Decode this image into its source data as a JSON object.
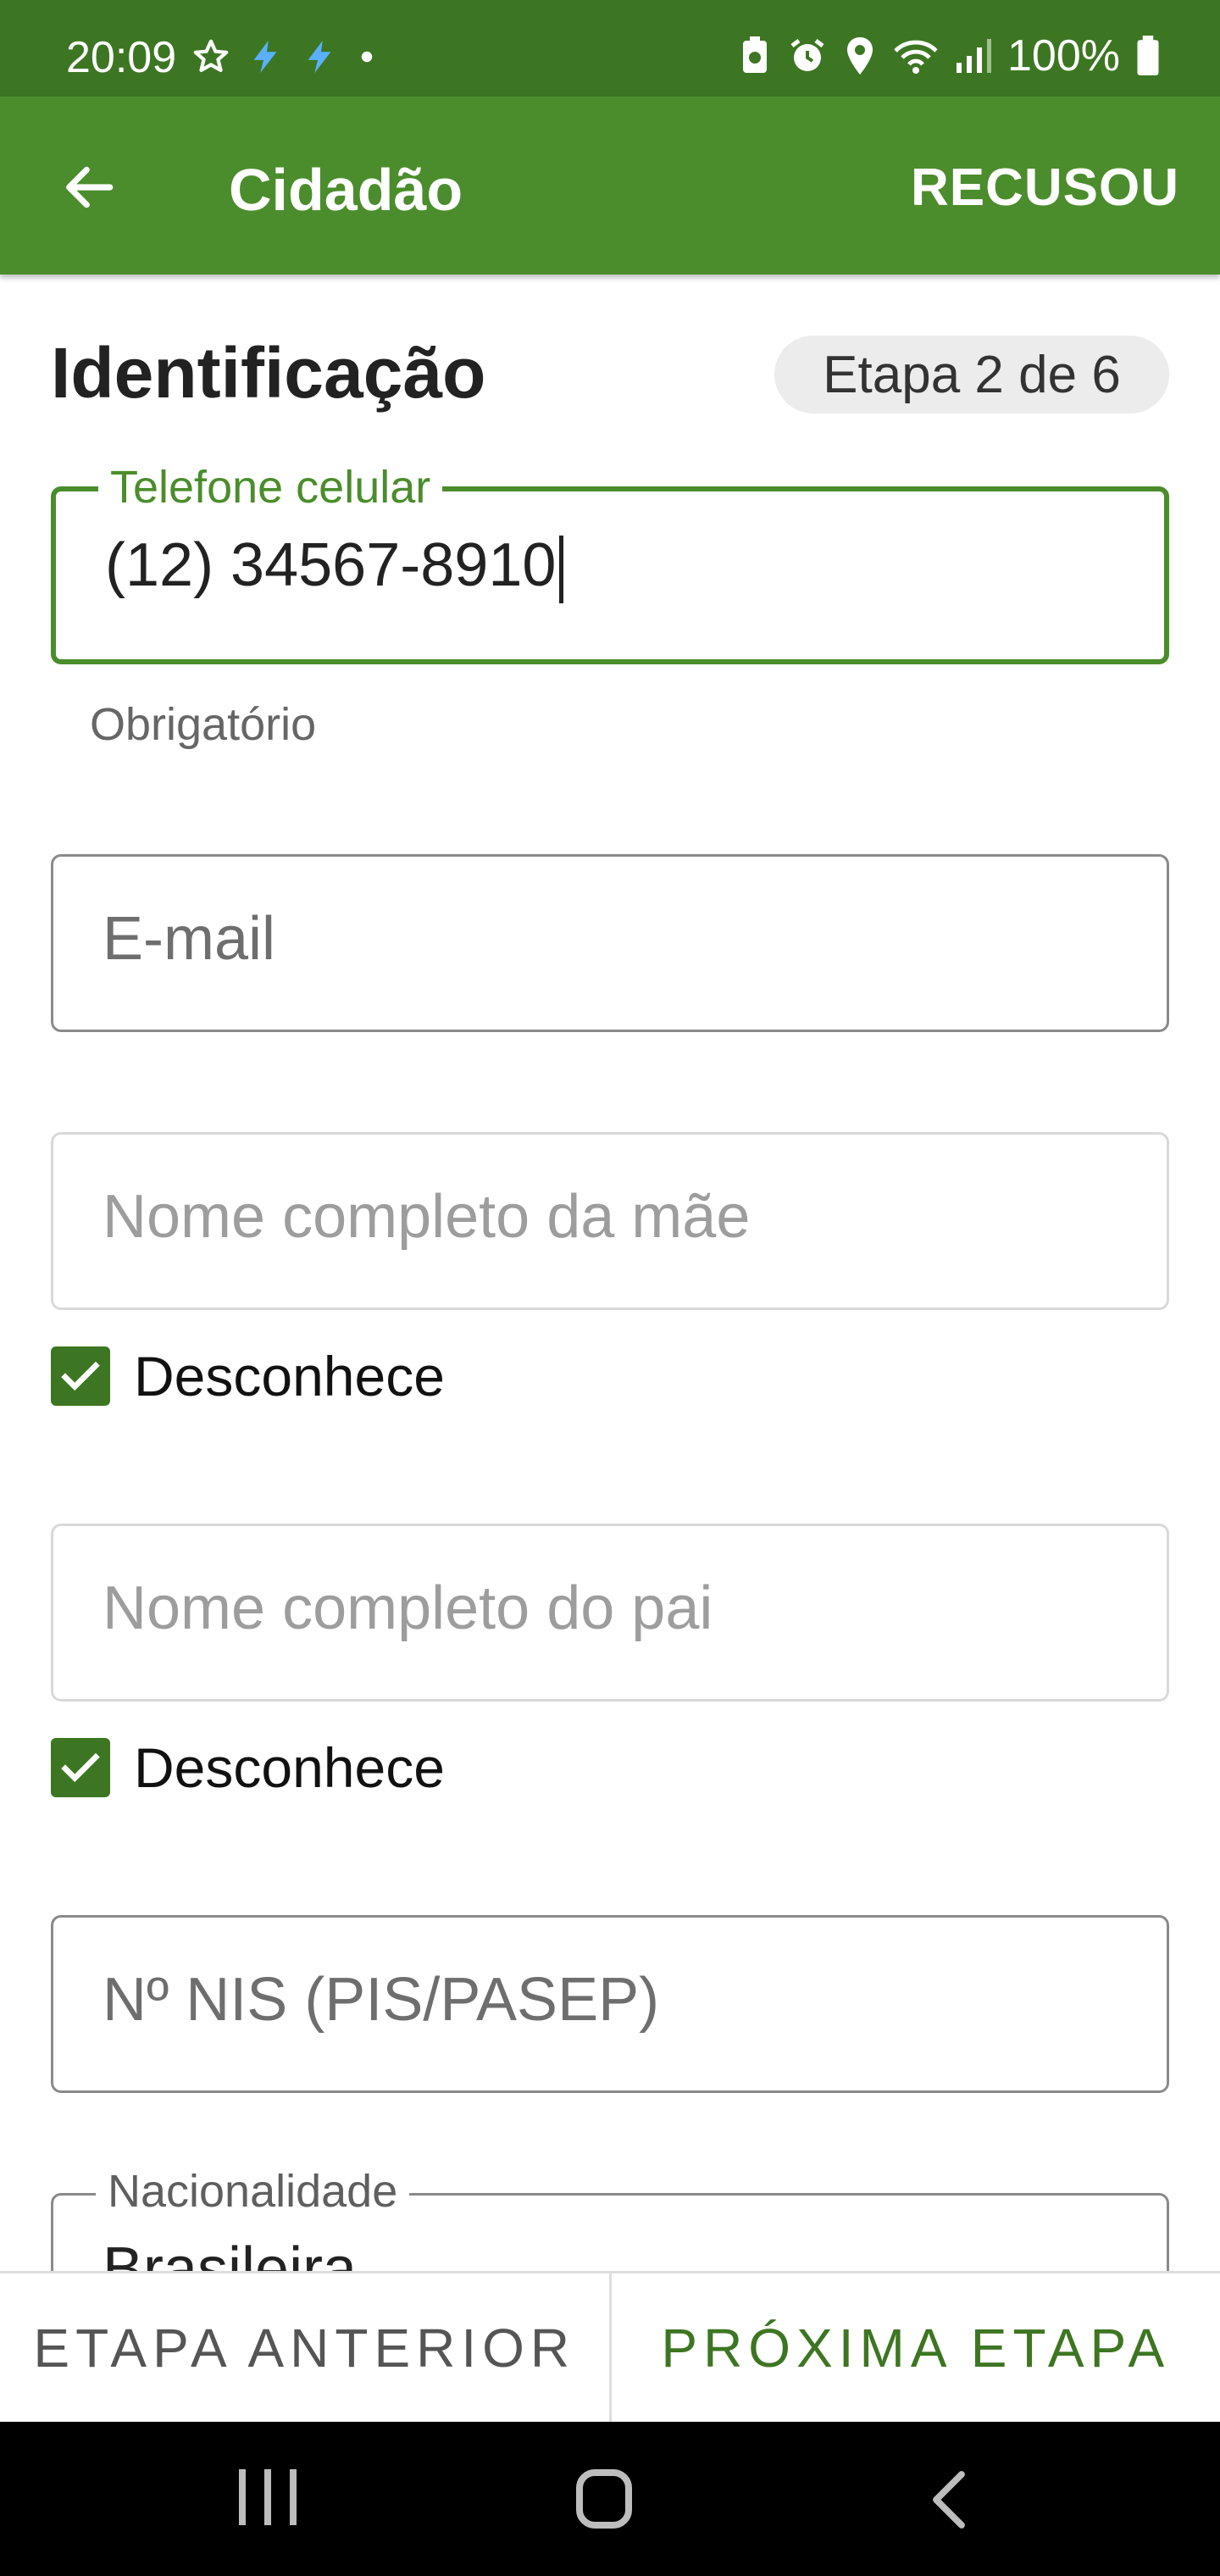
{
  "status_bar": {
    "time": "20:09",
    "battery_percent": "100%",
    "left_icons": [
      "star-icon",
      "bolt-icon",
      "bolt-icon",
      "dot-icon"
    ],
    "right_icons": [
      "battery-saver-icon",
      "alarm-icon",
      "location-icon",
      "wifi-icon",
      "signal-icon",
      "battery-icon"
    ]
  },
  "app_bar": {
    "title": "Cidadão",
    "action_label": "RECUSOU",
    "background": "#4b8d2c"
  },
  "section": {
    "title": "Identificação",
    "step_label": "Etapa 2 de 6"
  },
  "fields": {
    "phone": {
      "label": "Telefone celular",
      "value": "(12) 34567-8910",
      "helper": "Obrigatório"
    },
    "email": {
      "placeholder": "E-mail"
    },
    "mother_name": {
      "placeholder": "Nome completo da mãe",
      "unknown_label": "Desconhece",
      "unknown_checked": true
    },
    "father_name": {
      "placeholder": "Nome completo do pai",
      "unknown_label": "Desconhece",
      "unknown_checked": true
    },
    "nis": {
      "placeholder": "Nº NIS (PIS/PASEP)"
    },
    "nationality": {
      "label": "Nacionalidade",
      "value": "Brasileira"
    }
  },
  "actions": {
    "prev_label": "ETAPA ANTERIOR",
    "next_label": "PRÓXIMA ETAPA"
  },
  "colors": {
    "primary": "#4b8d2c",
    "status_bar": "#3d7622",
    "checkbox": "#3d7622"
  }
}
